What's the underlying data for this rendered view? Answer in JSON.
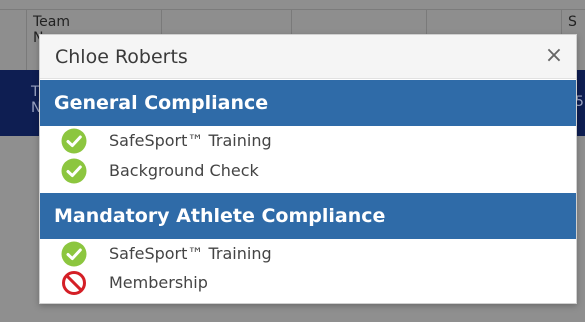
{
  "background": {
    "columns": [
      "Team\nN",
      "",
      "",
      "",
      "",
      "S"
    ],
    "selected_row_text": [
      "T\nN",
      "5"
    ]
  },
  "modal": {
    "title": "Chloe Roberts",
    "close_label": "×",
    "sections": [
      {
        "title": "General Compliance",
        "items": [
          {
            "label": "SafeSport™ Training",
            "status": "check-icon"
          },
          {
            "label": "Background Check",
            "status": "check-icon"
          }
        ]
      },
      {
        "title": "Mandatory Athlete Compliance",
        "items": [
          {
            "label": "SafeSport™ Training",
            "status": "check-icon"
          },
          {
            "label": "Membership",
            "status": "prohibited-icon"
          }
        ]
      }
    ]
  },
  "colors": {
    "section_header": "#2f6ba8",
    "check_green": "#8cc63f",
    "prohibited_red": "#d41f26",
    "selected_row": "#0e1e52"
  }
}
